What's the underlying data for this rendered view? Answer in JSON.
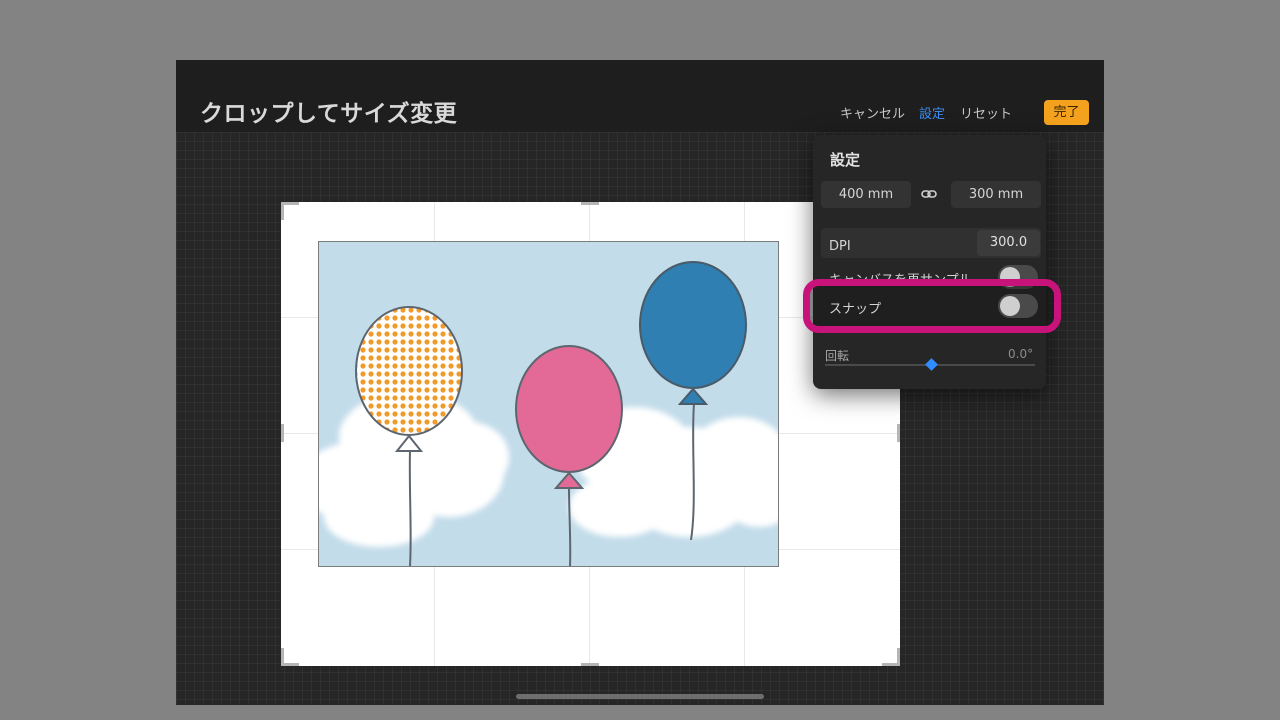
{
  "window": {
    "title": "クロップしてサイズ変更"
  },
  "toolbar": {
    "cancel_label": "キャンセル",
    "settings_label": "設定",
    "reset_label": "リセット",
    "done_label": "完了"
  },
  "settings_panel": {
    "title": "設定",
    "width_value": "400 mm",
    "height_value": "300 mm",
    "link_icon": "link-icon",
    "dpi_label": "DPI",
    "dpi_value": "300.0",
    "resample_label": "キャンバスを再サンプル",
    "resample_enabled": false,
    "snap_label": "スナップ",
    "snap_enabled": false,
    "rotation_label": "回転",
    "rotation_value": "0.0°",
    "rotation_level": 0.5
  },
  "colors": {
    "accent": "#3d8bf0",
    "done_button": "#f4a21d",
    "highlight": "#c8137a",
    "sky": "#c3dcea",
    "balloon_orange": "#f39a2b",
    "balloon_pink": "#e36a96",
    "balloon_blue": "#2f7fb2"
  }
}
